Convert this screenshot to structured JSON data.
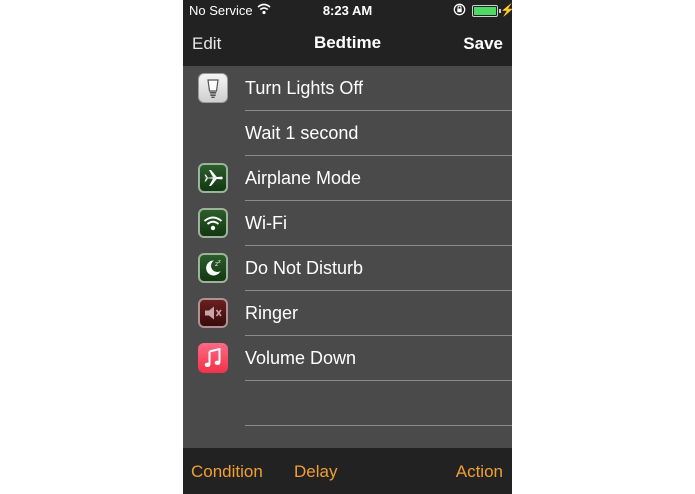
{
  "status_bar": {
    "carrier": "No Service",
    "time": "8:23 AM",
    "battery_level": 1.0
  },
  "nav": {
    "left": "Edit",
    "title": "Bedtime",
    "right": "Save"
  },
  "rows": [
    {
      "label": "Turn Lights Off",
      "icon": "lightbulb-icon"
    },
    {
      "label": "Wait 1 second",
      "icon": ""
    },
    {
      "label": "Airplane Mode",
      "icon": "airplane-icon"
    },
    {
      "label": "Wi-Fi",
      "icon": "wifi-icon"
    },
    {
      "label": "Do Not Disturb",
      "icon": "moon-icon"
    },
    {
      "label": "Ringer",
      "icon": "speaker-muted-icon"
    },
    {
      "label": "Volume Down",
      "icon": "music-note-icon"
    },
    {
      "label": "",
      "icon": ""
    }
  ],
  "toolbar": {
    "condition": "Condition",
    "delay": "Delay",
    "action": "Action"
  },
  "colors": {
    "accent": "#f0a030",
    "list_bg": "#4a4a4a",
    "bar_bg": "#222222"
  }
}
